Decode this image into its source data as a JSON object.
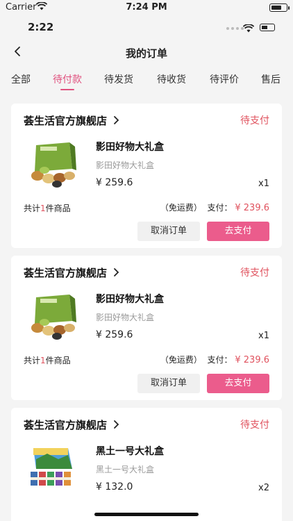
{
  "status_bar": {
    "carrier": "Carrier",
    "time": "7:24 PM"
  },
  "inner_status": {
    "time": "2:22"
  },
  "header": {
    "title": "我的订单"
  },
  "tabs": [
    {
      "label": "全部"
    },
    {
      "label": "待付款"
    },
    {
      "label": "待发货"
    },
    {
      "label": "待收货"
    },
    {
      "label": "待评价"
    },
    {
      "label": "售后"
    }
  ],
  "active_tab": "待付款",
  "colors": {
    "accent": "#e0507e",
    "status_red": "#e0525e",
    "pay_button": "#eb5c8c"
  },
  "orders": [
    {
      "store": "荟生活官方旗舰店",
      "status": "待支付",
      "product_name": "影田好物大礼盒",
      "product_spec": "影田好物大礼盒",
      "price": "¥ 259.6",
      "quantity": "x1",
      "count_prefix": "共计",
      "count_num": "1",
      "count_suffix": "件商品",
      "shipping": "（免运费）",
      "pay_label": "支付：",
      "pay_amount": "¥ 239.6",
      "cancel_label": "取消订单",
      "pay_button_label": "去支付"
    },
    {
      "store": "荟生活官方旗舰店",
      "status": "待支付",
      "product_name": "影田好物大礼盒",
      "product_spec": "影田好物大礼盒",
      "price": "¥ 259.6",
      "quantity": "x1",
      "count_prefix": "共计",
      "count_num": "1",
      "count_suffix": "件商品",
      "shipping": "（免运费）",
      "pay_label": "支付：",
      "pay_amount": "¥ 239.6",
      "cancel_label": "取消订单",
      "pay_button_label": "去支付"
    },
    {
      "store": "荟生活官方旗舰店",
      "status": "待支付",
      "product_name": "黑土一号大礼盒",
      "product_spec": "黑土一号大礼盒",
      "price": "¥ 132.0",
      "quantity": "x2"
    }
  ]
}
